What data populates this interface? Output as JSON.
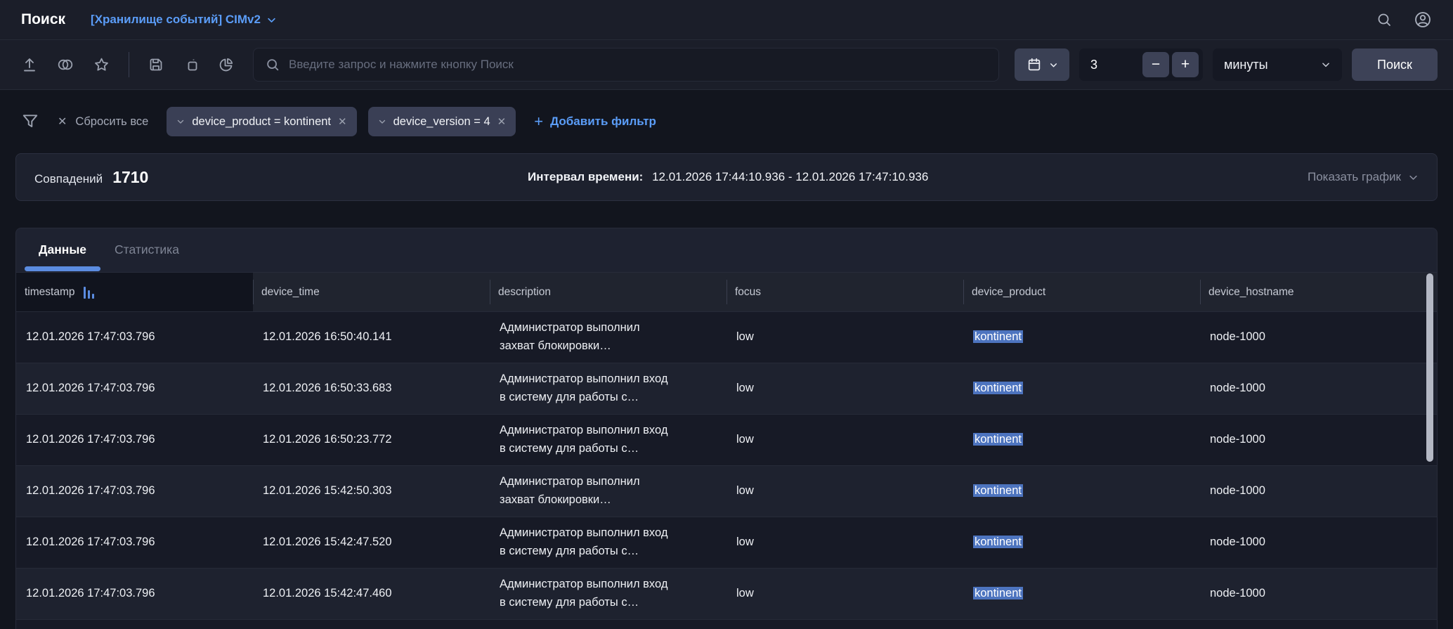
{
  "header": {
    "title": "Поиск",
    "storage_selector": "[Хранилище событий] CIMv2"
  },
  "toolbar": {
    "search_placeholder": "Введите запрос и нажмите кнопку Поиск",
    "interval_value": "3",
    "interval_unit": "минуты",
    "search_button": "Поиск"
  },
  "filters": {
    "clear_all": "Сбросить все",
    "chips": [
      {
        "label": "device_product = kontinent"
      },
      {
        "label": "device_version = 4"
      }
    ],
    "add_filter": "Добавить фильтр"
  },
  "summary": {
    "matches_label": "Совпадений",
    "matches_count": "1710",
    "interval_label": "Интервал времени:",
    "interval_value": "12.01.2026 17:44:10.936 - 12.01.2026 17:47:10.936",
    "show_chart": "Показать график"
  },
  "tabs": [
    {
      "label": "Данные",
      "active": true
    },
    {
      "label": "Статистика",
      "active": false
    }
  ],
  "table": {
    "columns": [
      "timestamp",
      "device_time",
      "description",
      "focus",
      "device_product",
      "device_hostname"
    ],
    "sorted_column": "timestamp",
    "highlight_column": "device_product",
    "rows": [
      {
        "timestamp": "12.01.2026 17:47:03.796",
        "device_time": "12.01.2026 16:50:40.141",
        "description": "Администратор выполнил захват блокировки…",
        "focus": "low",
        "device_product": "kontinent",
        "device_hostname": "node-1000"
      },
      {
        "timestamp": "12.01.2026 17:47:03.796",
        "device_time": "12.01.2026 16:50:33.683",
        "description": "Администратор выполнил вход в систему для работы с…",
        "focus": "low",
        "device_product": "kontinent",
        "device_hostname": "node-1000"
      },
      {
        "timestamp": "12.01.2026 17:47:03.796",
        "device_time": "12.01.2026 16:50:23.772",
        "description": "Администратор выполнил вход в систему для работы с…",
        "focus": "low",
        "device_product": "kontinent",
        "device_hostname": "node-1000"
      },
      {
        "timestamp": "12.01.2026 17:47:03.796",
        "device_time": "12.01.2026 15:42:50.303",
        "description": "Администратор выполнил захват блокировки…",
        "focus": "low",
        "device_product": "kontinent",
        "device_hostname": "node-1000"
      },
      {
        "timestamp": "12.01.2026 17:47:03.796",
        "device_time": "12.01.2026 15:42:47.520",
        "description": "Администратор выполнил вход в систему для работы с…",
        "focus": "low",
        "device_product": "kontinent",
        "device_hostname": "node-1000"
      },
      {
        "timestamp": "12.01.2026 17:47:03.796",
        "device_time": "12.01.2026 15:42:47.460",
        "description": "Администратор выполнил вход в систему для работы с…",
        "focus": "low",
        "device_product": "kontinent",
        "device_hostname": "node-1000"
      }
    ]
  },
  "icons": {
    "close": "✕",
    "plus": "+",
    "minus": "−"
  },
  "colors": {
    "accent_blue": "#5b9df8",
    "tab_underline": "#5b8ce0",
    "highlight_bg": "#4d74bf",
    "panel_bg": "#1d212e",
    "page_bg": "#12151e",
    "bar_bg": "#1b1e29"
  }
}
